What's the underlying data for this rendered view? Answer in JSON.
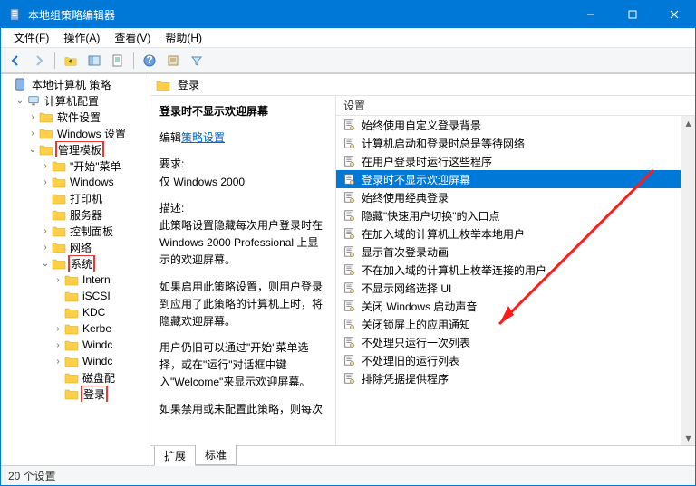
{
  "window": {
    "title": "本地组策略编辑器"
  },
  "menu": {
    "file": "文件(F)",
    "action": "操作(A)",
    "view": "查看(V)",
    "help": "帮助(H)"
  },
  "tree": {
    "root": "本地计算机 策略",
    "computer": "计算机配置",
    "software": "软件设置",
    "windows": "Windows 设置",
    "admin": "管理模板",
    "start": "\"开始\"菜单",
    "windows2": "Windows",
    "printer": "打印机",
    "server": "服务器",
    "cpanel": "控制面板",
    "network": "网络",
    "system": "系统",
    "intern": "Intern",
    "iscsi": "iSCSI",
    "kdc": "KDC",
    "kerbe": "Kerbe",
    "windc": "Windc",
    "windc2": "Windc",
    "diskcfg": "磁盘配",
    "logon": "登录"
  },
  "heading": "登录",
  "desc": {
    "title": "登录时不显示欢迎屏幕",
    "editPrefix": "编辑",
    "editLink": "策略设置",
    "reqLabel": "要求:",
    "reqVal": "仅 Windows 2000",
    "descLabel": "描述:",
    "p1": "此策略设置隐藏每次用户登录时在 Windows 2000 Professional 上显示的欢迎屏幕。",
    "p2": "如果启用此策略设置，则用户登录到应用了此策略的计算机上时，将隐藏欢迎屏幕。",
    "p3": "用户仍旧可以通过\"开始\"菜单选择，或在\"运行\"对话框中键入\"Welcome\"来显示欢迎屏幕。",
    "p4": "如果禁用或未配置此策略，则每次"
  },
  "listHeader": "设置",
  "items": [
    "排除凭据提供程序",
    "不处理旧的运行列表",
    "不处理只运行一次列表",
    "关闭锁屏上的应用通知",
    "关闭 Windows 启动声音",
    "不显示网络选择 UI",
    "不在加入域的计算机上枚举连接的用户",
    "显示首次登录动画",
    "在加入域的计算机上枚举本地用户",
    "隐藏\"快速用户切换\"的入口点",
    "始终使用经典登录",
    "登录时不显示欢迎屏幕",
    "在用户登录时运行这些程序",
    "计算机启动和登录时总是等待网络",
    "始终使用自定义登录背景"
  ],
  "selectedIndex": 11,
  "tabs": {
    "ext": "扩展",
    "std": "标准"
  },
  "status": "20 个设置"
}
